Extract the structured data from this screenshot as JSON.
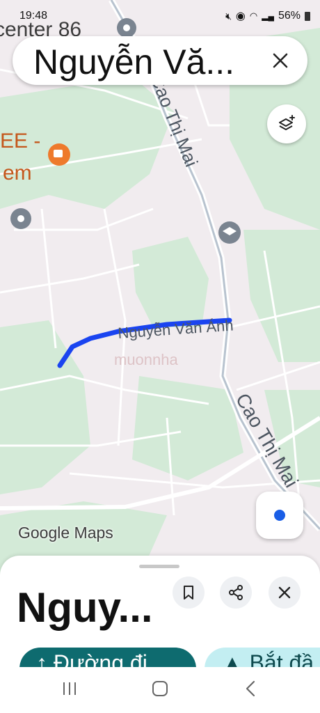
{
  "status_bar": {
    "time": "19:48",
    "battery": "56%"
  },
  "search": {
    "query": "Nguyễn Vă..."
  },
  "map": {
    "labels": {
      "poi_center": "center 86",
      "cafe_line1": "EE -",
      "cafe_line2": "em",
      "road_north": "Cao Thị Mai",
      "road_south": "Cao Thị Mai",
      "selected_road": "Nguyễn Văn Ánh",
      "watermark": "muonnha"
    },
    "logo": "Google Maps",
    "colors": {
      "route": "#1a44f0",
      "park": "#d5ecd9",
      "land": "#f1ecef",
      "road": "#ffffff"
    }
  },
  "sheet": {
    "title": "Nguy...",
    "directions_label": "↑ Đường đi",
    "start_label": "▲ Bắt đầ"
  },
  "icons": [
    "close-icon",
    "layers-icon",
    "my-location-icon",
    "bookmark-icon",
    "share-icon",
    "recent-apps-icon",
    "home-icon",
    "back-icon"
  ]
}
